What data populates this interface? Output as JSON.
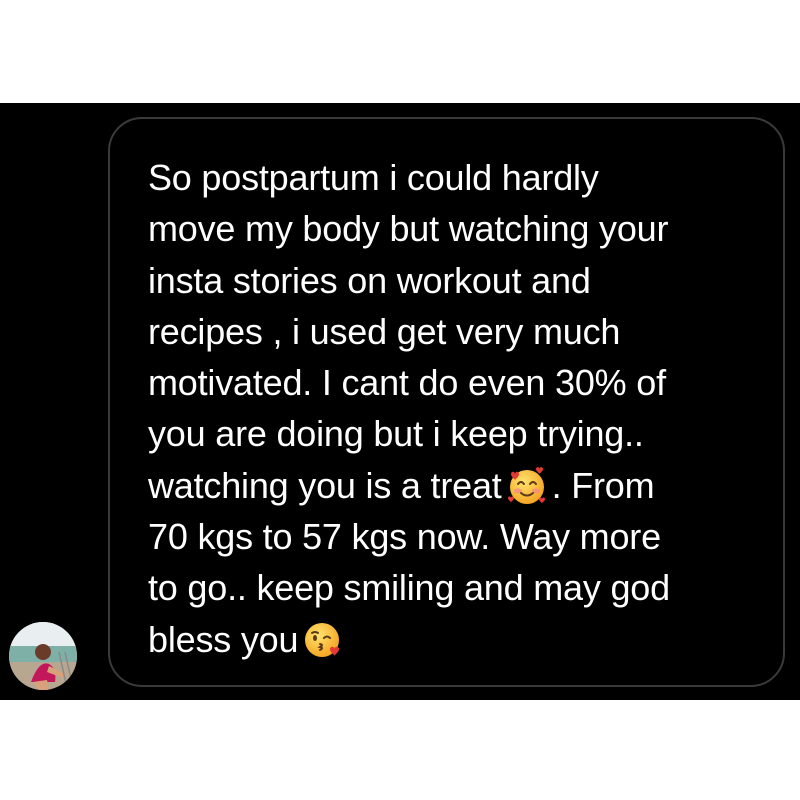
{
  "message": {
    "lines": [
      "So postpartum i could hardly",
      "move my body but watching your",
      "insta stories on workout and",
      "recipes , i used get very much",
      "motivated. I cant do even 30% of",
      "you are doing but i keep trying..",
      {
        "before": "watching you is a treat",
        "emoji": "smiling-face-with-hearts-icon",
        "after": ". From"
      },
      "70 kgs to 57 kgs now. Way more",
      "to go.. keep smiling and may god",
      {
        "before": "bless you",
        "emoji": "face-blowing-kiss-icon",
        "after": ""
      }
    ]
  },
  "colors": {
    "background": "#000000",
    "bubble_border": "#3a3a3c",
    "text": "#ffffff",
    "page": "#ffffff"
  }
}
